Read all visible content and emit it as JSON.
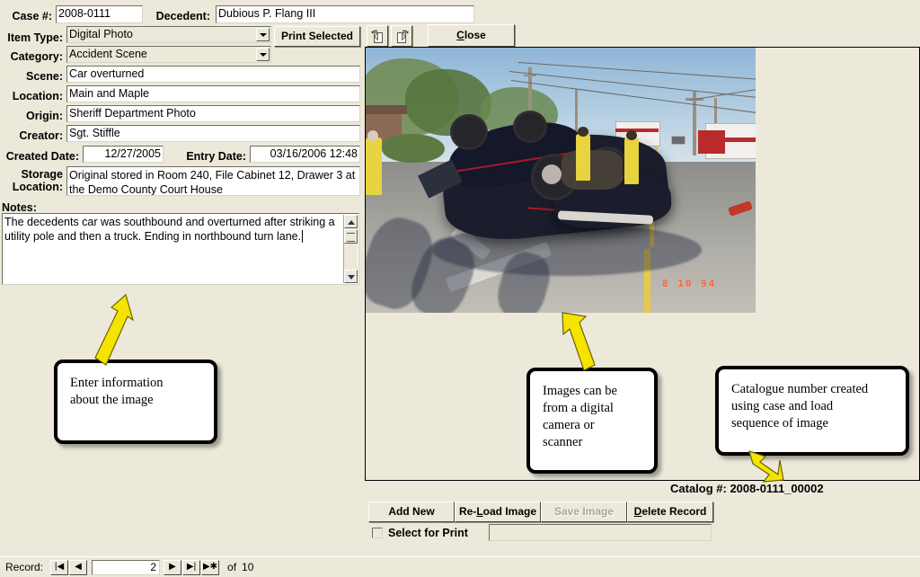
{
  "form": {
    "fields": {
      "case_label": "Case #:",
      "case_value": "2008-0111",
      "decedent_label": "Decedent:",
      "decedent_value": "Dubious P. Flang III",
      "item_type_label": "Item Type:",
      "item_type_value": "Digital Photo",
      "category_label": "Category:",
      "category_value": "Accident Scene",
      "scene_label": "Scene:",
      "scene_value": "Car overturned",
      "location_label": "Location:",
      "location_value": "Main and Maple",
      "origin_label": "Origin:",
      "origin_value": "Sheriff Department Photo",
      "creator_label": "Creator:",
      "creator_value": "Sgt. Stiffle",
      "created_date_label": "Created Date:",
      "created_date_value": "12/27/2005",
      "entry_date_label": "Entry Date:",
      "entry_date_value": "03/16/2006 12:48",
      "storage_label_line1": "Storage",
      "storage_label_line2": "Location:",
      "storage_value": "Original stored in Room 240, File Cabinet 12, Drawer 3 at the Demo County Court House",
      "notes_label": "Notes:",
      "notes_value": "The decedents car was southbound and overturned after striking a utility pole and then a truck. Ending in northbound turn lane."
    }
  },
  "toolbar": {
    "print_selected_label": "Print Selected",
    "rotate_left_icon": "rotate-left-icon",
    "rotate_right_icon": "rotate-right-icon",
    "close_label": "Close"
  },
  "photo": {
    "date_stamp": "8 10 94",
    "alt": "Overturned dark blue car on a road with firefighters and emergency vehicles"
  },
  "catalog": {
    "label": "Catalog #:",
    "value": "2008-0111_00002",
    "full": "Catalog #: 2008-0111_00002"
  },
  "actions": {
    "add_new": "Add New",
    "reload_image": "Re-Load Image",
    "save_image": "Save Image",
    "delete_record": "Delete Record",
    "select_for_print": "Select for Print",
    "print_note_value": ""
  },
  "record_nav": {
    "label": "Record:",
    "first": "|◀",
    "prev": "◀",
    "current": "2",
    "next": "▶",
    "last": "▶|",
    "new": "▶✱",
    "of_label": "of",
    "total": "10"
  },
  "callouts": [
    {
      "id": "callout-enter-information",
      "text": "Enter information\nabout the image"
    },
    {
      "id": "callout-image-source",
      "text": "Images can be\nfrom a digital\ncamera or\nscanner"
    },
    {
      "id": "callout-catalogue-number",
      "text": "Catalogue number created\nusing case and load\nsequence of image"
    }
  ],
  "colors": {
    "window_bg": "#ece9da",
    "field_bg": "#ffffff",
    "callout_border": "#000000",
    "arrow": "#f5e400",
    "catalog_text": "#000000"
  }
}
